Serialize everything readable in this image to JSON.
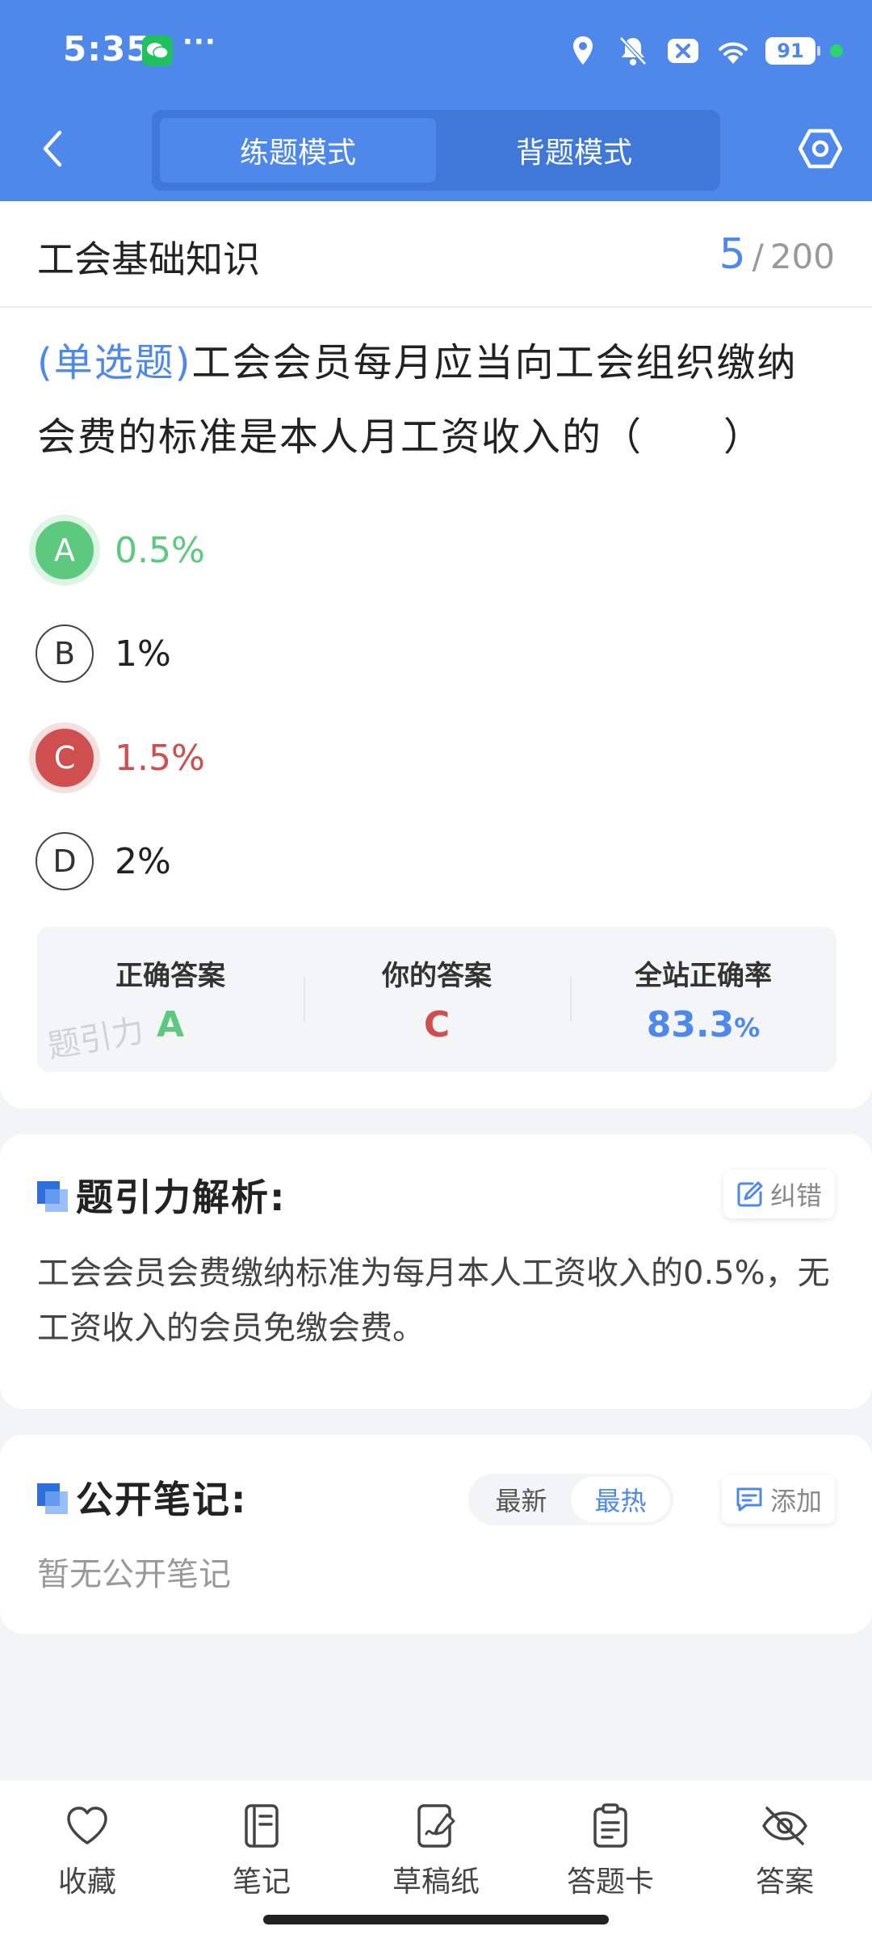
{
  "status_bar": {
    "time": "5:35",
    "dots": "···",
    "battery": "91"
  },
  "nav": {
    "tabs": [
      {
        "label": "练题模式",
        "active": true
      },
      {
        "label": "背题模式",
        "active": false
      }
    ]
  },
  "question": {
    "subject": "工会基础知识",
    "current": "5",
    "separator": "/",
    "total": "200",
    "type": "(单选题)",
    "text": "工会会员每月应当向工会组织缴纳会费的标准是本人月工资收入的（　　）",
    "options": [
      {
        "letter": "A",
        "text": "0.5%",
        "state": "correct"
      },
      {
        "letter": "B",
        "text": "1%",
        "state": "normal"
      },
      {
        "letter": "C",
        "text": "1.5%",
        "state": "wrong"
      },
      {
        "letter": "D",
        "text": "2%",
        "state": "normal"
      }
    ]
  },
  "answer_summary": {
    "correct_label": "正确答案",
    "correct_value": "A",
    "yours_label": "你的答案",
    "yours_value": "C",
    "rate_label": "全站正确率",
    "rate_value": "83.3",
    "rate_unit": "%",
    "watermark": "题引力"
  },
  "analysis": {
    "title": "题引力解析:",
    "report_label": "纠错",
    "text": "工会会员会费缴纳标准为每月本人工资收入的0.5%，无工资收入的会员免缴会费。"
  },
  "notes": {
    "title": "公开笔记:",
    "sort_options": [
      {
        "label": "最新",
        "active": false
      },
      {
        "label": "最热",
        "active": true
      }
    ],
    "add_label": "添加",
    "empty_text": "暂无公开笔记"
  },
  "bottom_nav": [
    {
      "label": "收藏",
      "icon": "heart-icon"
    },
    {
      "label": "笔记",
      "icon": "notebook-icon"
    },
    {
      "label": "草稿纸",
      "icon": "draft-paper-icon"
    },
    {
      "label": "答题卡",
      "icon": "answer-card-icon"
    },
    {
      "label": "答案",
      "icon": "eye-off-icon"
    }
  ],
  "colors": {
    "primary": "#4d88ea",
    "correct": "#5cc97e",
    "wrong": "#cf4e4e"
  }
}
